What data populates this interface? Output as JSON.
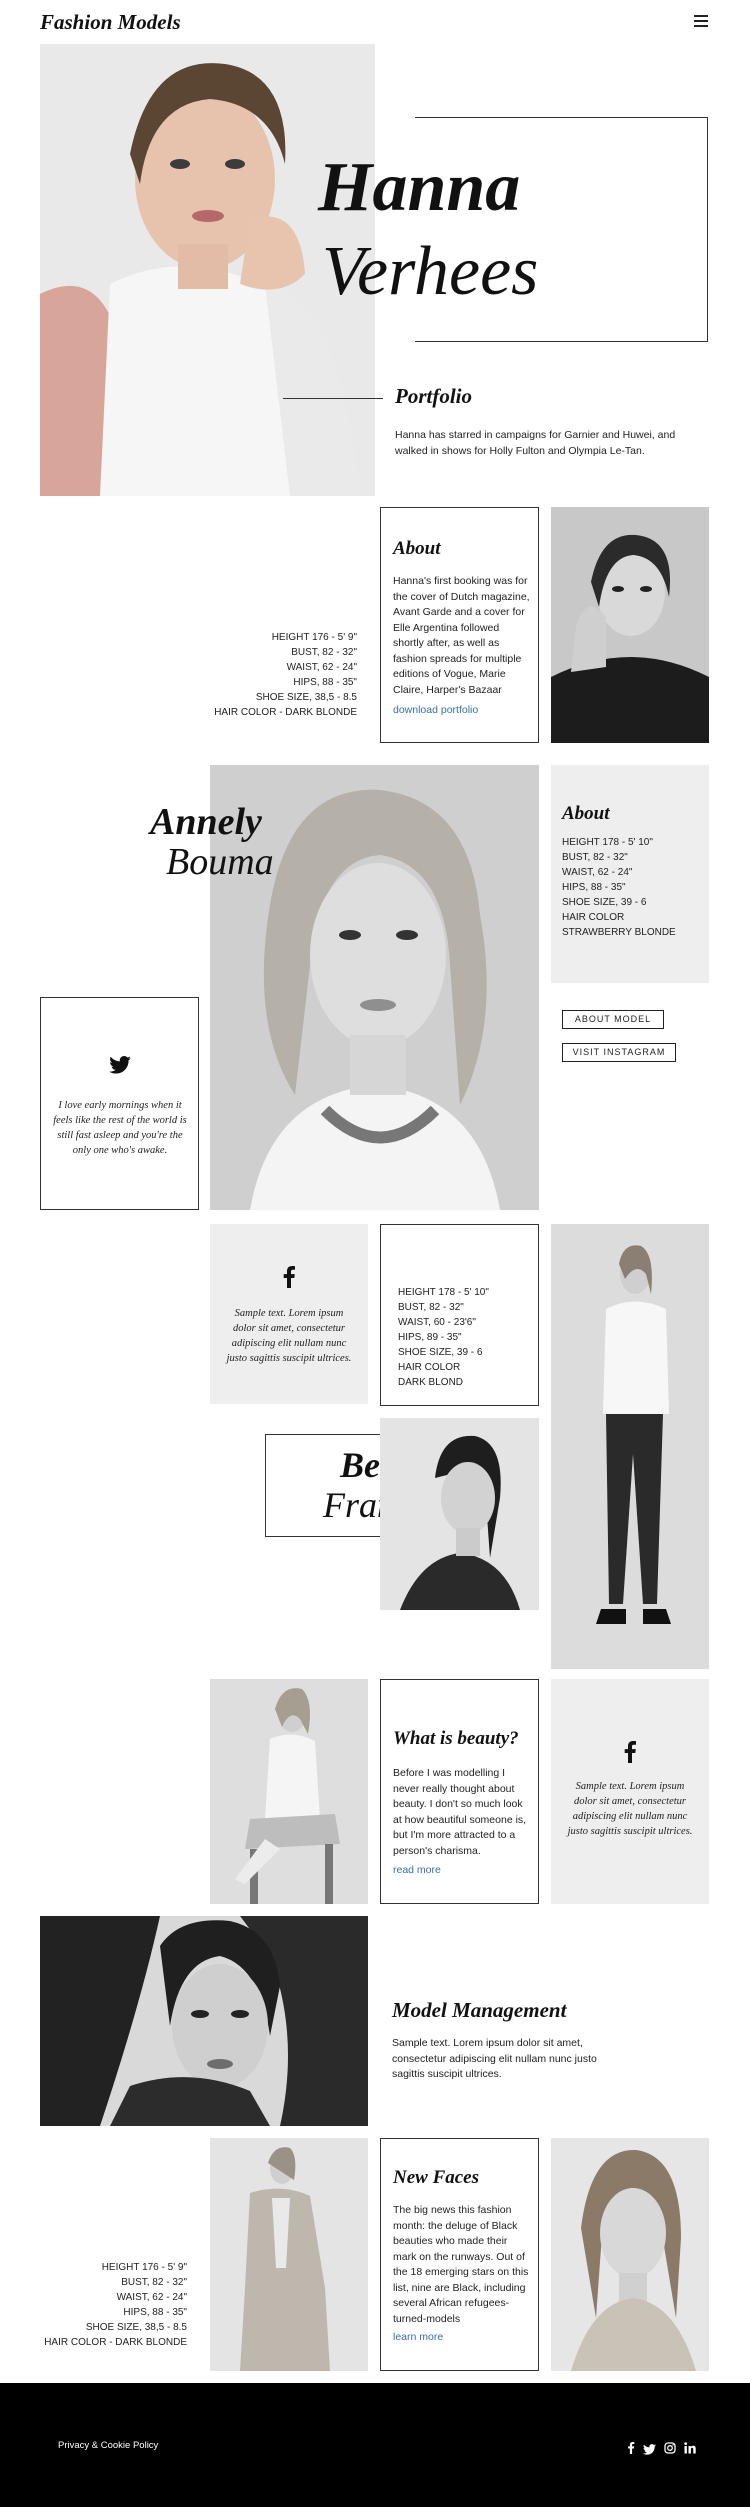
{
  "header": {
    "logo": "Fashion Models",
    "menu_icon": "hamburger-menu-icon"
  },
  "hero": {
    "first_name": "Hanna",
    "last_name": "Verhees",
    "portfolio_title": "Portfolio",
    "portfolio_text": "Hanna has starred in campaigns for Garnier and Huwei, and walked in shows for Holly Fulton and Olympia Le-Tan."
  },
  "hanna_stats": [
    "HEIGHT 176 - 5' 9\"",
    "BUST, 82 - 32\"",
    "WAIST, 62 - 24\"",
    "HIPS, 88 - 35\"",
    "SHOE SIZE, 38,5 - 8.5",
    "HAIR COLOR - DARK BLONDE"
  ],
  "about_hanna": {
    "title": "About",
    "text": "Hanna's first booking was for the cover of Dutch magazine, Avant Garde and a cover for Elle Argentina followed shortly after, as well as fashion spreads for multiple editions of Vogue, Marie Claire, Harper's Bazaar",
    "link": "download portfolio"
  },
  "annely": {
    "first_name": "Annely",
    "last_name": "Bouma",
    "about_title": "About",
    "stats": [
      "HEIGHT 178 - 5' 10\"",
      "BUST, 82 - 32\"",
      "WAIST, 62 - 24\"",
      "HIPS, 88 - 35\"",
      "SHOE SIZE, 39 - 6",
      "HAIR COLOR",
      "STRAWBERRY BLONDE"
    ],
    "about_button": "ABOUT MODEL",
    "instagram_button": "VISIT INSTAGRAM"
  },
  "twitter_quote": {
    "icon": "twitter-icon",
    "text": "I love early mornings when it feels like the rest of the world is still fast asleep and you're the only one who's awake."
  },
  "facebook_card_1": {
    "icon": "facebook-icon",
    "text": "Sample text. Lorem ipsum dolor sit amet, consectetur adipiscing elit nullam nunc justo sagittis suscipit ultrices."
  },
  "bette": {
    "first_name": "Bette",
    "last_name": "Franke",
    "stats": [
      "HEIGHT 178 - 5' 10\"",
      "BUST, 82 - 32\"",
      "WAIST, 60 - 23'6\"",
      "HIPS, 89 - 35\"",
      "SHOE SIZE, 39 - 6",
      "HAIR COLOR",
      "DARK BLOND"
    ]
  },
  "beauty": {
    "title": "What is beauty?",
    "text": "Before I was modelling I never really thought about beauty. I don't so much look at how beautiful someone is, but I'm more attracted to a person's charisma.",
    "link": "read more"
  },
  "facebook_card_2": {
    "icon": "facebook-icon",
    "text": "Sample text. Lorem ipsum dolor sit amet, consectetur adipiscing elit nullam nunc justo sagittis suscipit ultrices."
  },
  "management": {
    "title": "Model Management",
    "text": "Sample text. Lorem ipsum dolor sit amet, consectetur adipiscing elit nullam nunc justo sagittis suscipit ultrices."
  },
  "new_faces": {
    "title": "New Faces",
    "text": "The big news this fashion month: the deluge of Black beauties who made their mark on the runways. Out of the 18 emerging stars on this list, nine are Black, including several African refugees-turned-models",
    "link": "learn more",
    "stats": [
      "HEIGHT 176 - 5' 9\"",
      "BUST, 82 - 32\"",
      "WAIST, 62 - 24\"",
      "HIPS, 88 - 35\"",
      "SHOE SIZE, 38,5 - 8.5",
      "HAIR COLOR - DARK BLONDE"
    ]
  },
  "footer": {
    "policy": "Privacy & Cookie Policy",
    "social_icons": [
      "facebook-icon",
      "twitter-icon",
      "instagram-icon",
      "linkedin-icon"
    ]
  },
  "colors": {
    "link": "#3a6ea5",
    "footer_bg": "#000000",
    "card_gray": "#eeeeee"
  }
}
